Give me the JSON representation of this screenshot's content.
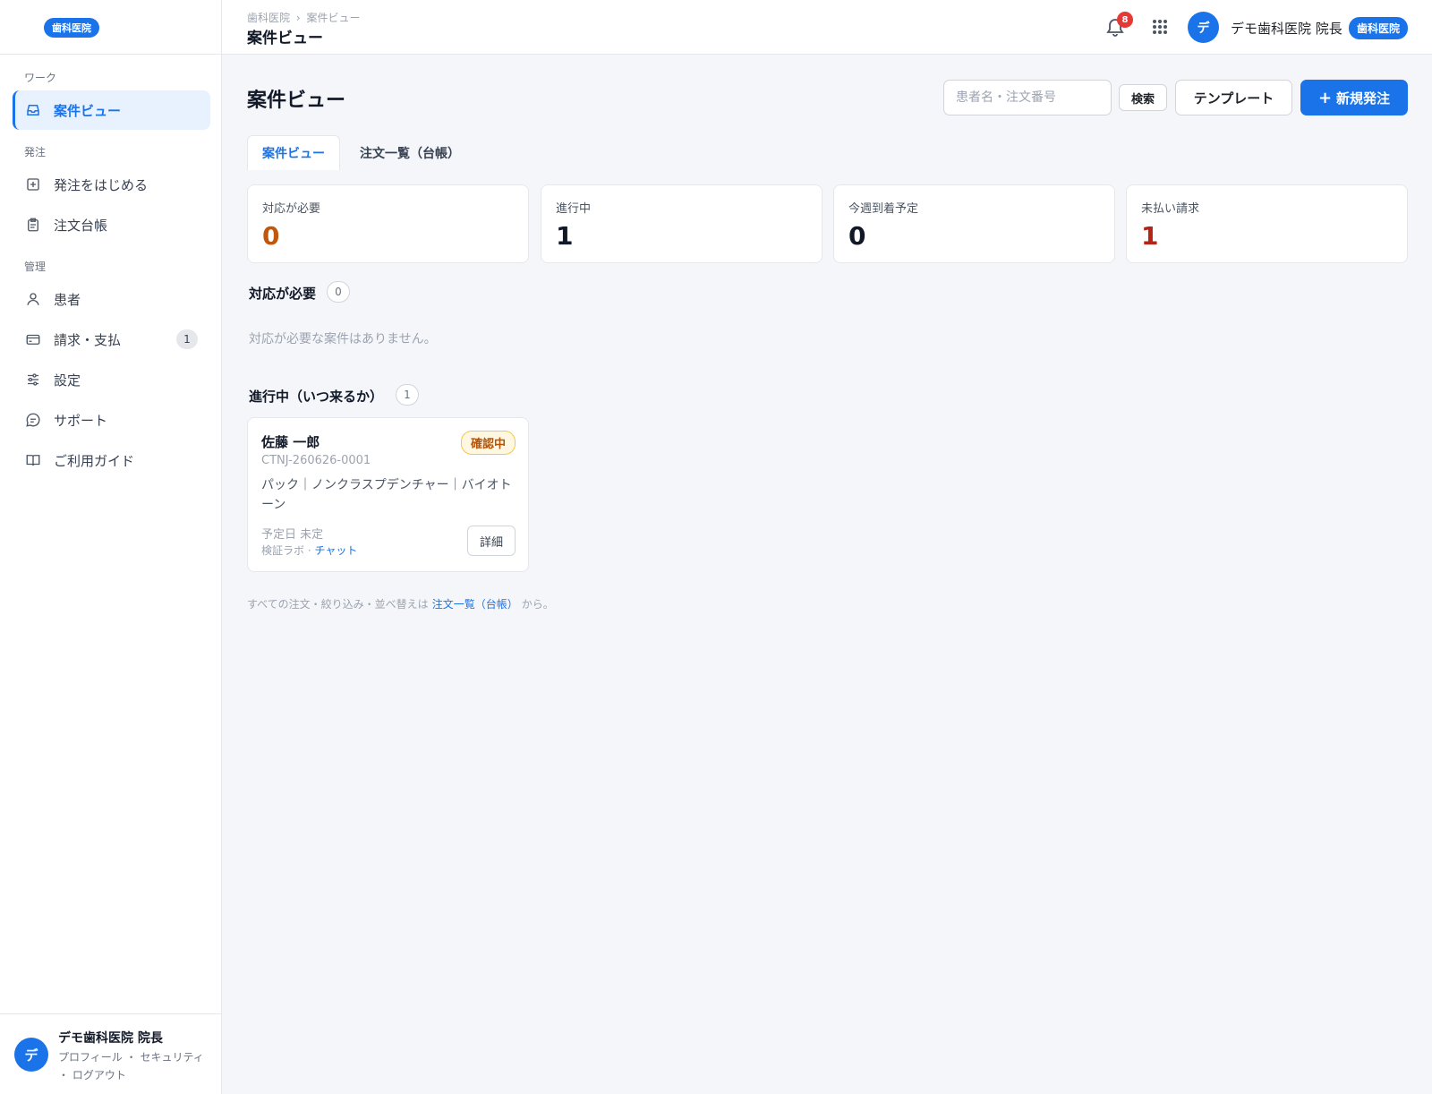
{
  "sidebar": {
    "logo_badge": "歯科医院",
    "sections": {
      "work": "ワーク",
      "order": "発注",
      "manage": "管理"
    },
    "items": [
      {
        "label": "案件ビュー",
        "icon": "inbox-icon"
      },
      {
        "label": "発注をはじめる",
        "icon": "plus-square-icon"
      },
      {
        "label": "注文台帳",
        "icon": "clipboard-icon"
      },
      {
        "label": "患者",
        "icon": "user-icon"
      },
      {
        "label": "請求・支払",
        "icon": "card-icon",
        "count": "1"
      },
      {
        "label": "設定",
        "icon": "sliders-icon"
      },
      {
        "label": "サポート",
        "icon": "chat-icon"
      },
      {
        "label": "ご利用ガイド",
        "icon": "book-icon"
      }
    ],
    "footer": {
      "avatar": "デ",
      "name": "デモ歯科医院 院長",
      "profile": "プロフィール",
      "security": "セキュリティ",
      "logout": "ログアウト",
      "sep": "・"
    }
  },
  "topbar": {
    "breadcrumb": [
      "歯科医院",
      "›",
      "案件ビュー"
    ],
    "title": "案件ビュー",
    "notification_count": "8",
    "avatar": "デ",
    "user_name": "デモ歯科医院 院長",
    "role_badge": "歯科医院"
  },
  "main": {
    "title": "案件ビュー",
    "search_placeholder": "患者名・注文番号",
    "search_button": "検索",
    "template_button": "テンプレート",
    "new_order_plus": "+",
    "new_order_button": "新規発注",
    "tabs": [
      "案件ビュー",
      "注文一覧（台帳）"
    ],
    "stats": [
      {
        "label": "対応が必要",
        "value": "0",
        "color": "#c2570c"
      },
      {
        "label": "進行中",
        "value": "1",
        "color": "#111827"
      },
      {
        "label": "今週到着予定",
        "value": "0",
        "color": "#111827"
      },
      {
        "label": "未払い請求",
        "value": "1",
        "color": "#b42318"
      }
    ],
    "action_required": {
      "title": "対応が必要",
      "count": "0",
      "empty_message": "対応が必要な案件はありません。"
    },
    "in_progress": {
      "title": "進行中（いつ来るか）",
      "count": "1",
      "cards": [
        {
          "patient": "佐藤 一郎",
          "status": "確認中",
          "order_no": "CTNJ-260626-0001",
          "description": "パック｜ノンクラスプデンチャー｜バイオトーン",
          "due": "予定日 未定",
          "lab": "検証ラボ · ",
          "chat": "チャット",
          "detail_button": "詳細"
        }
      ]
    },
    "footnote": {
      "prefix": "すべての注文・絞り込み・並べ替えは",
      "link": "注文一覧（台帳）",
      "suffix": "から。"
    }
  }
}
